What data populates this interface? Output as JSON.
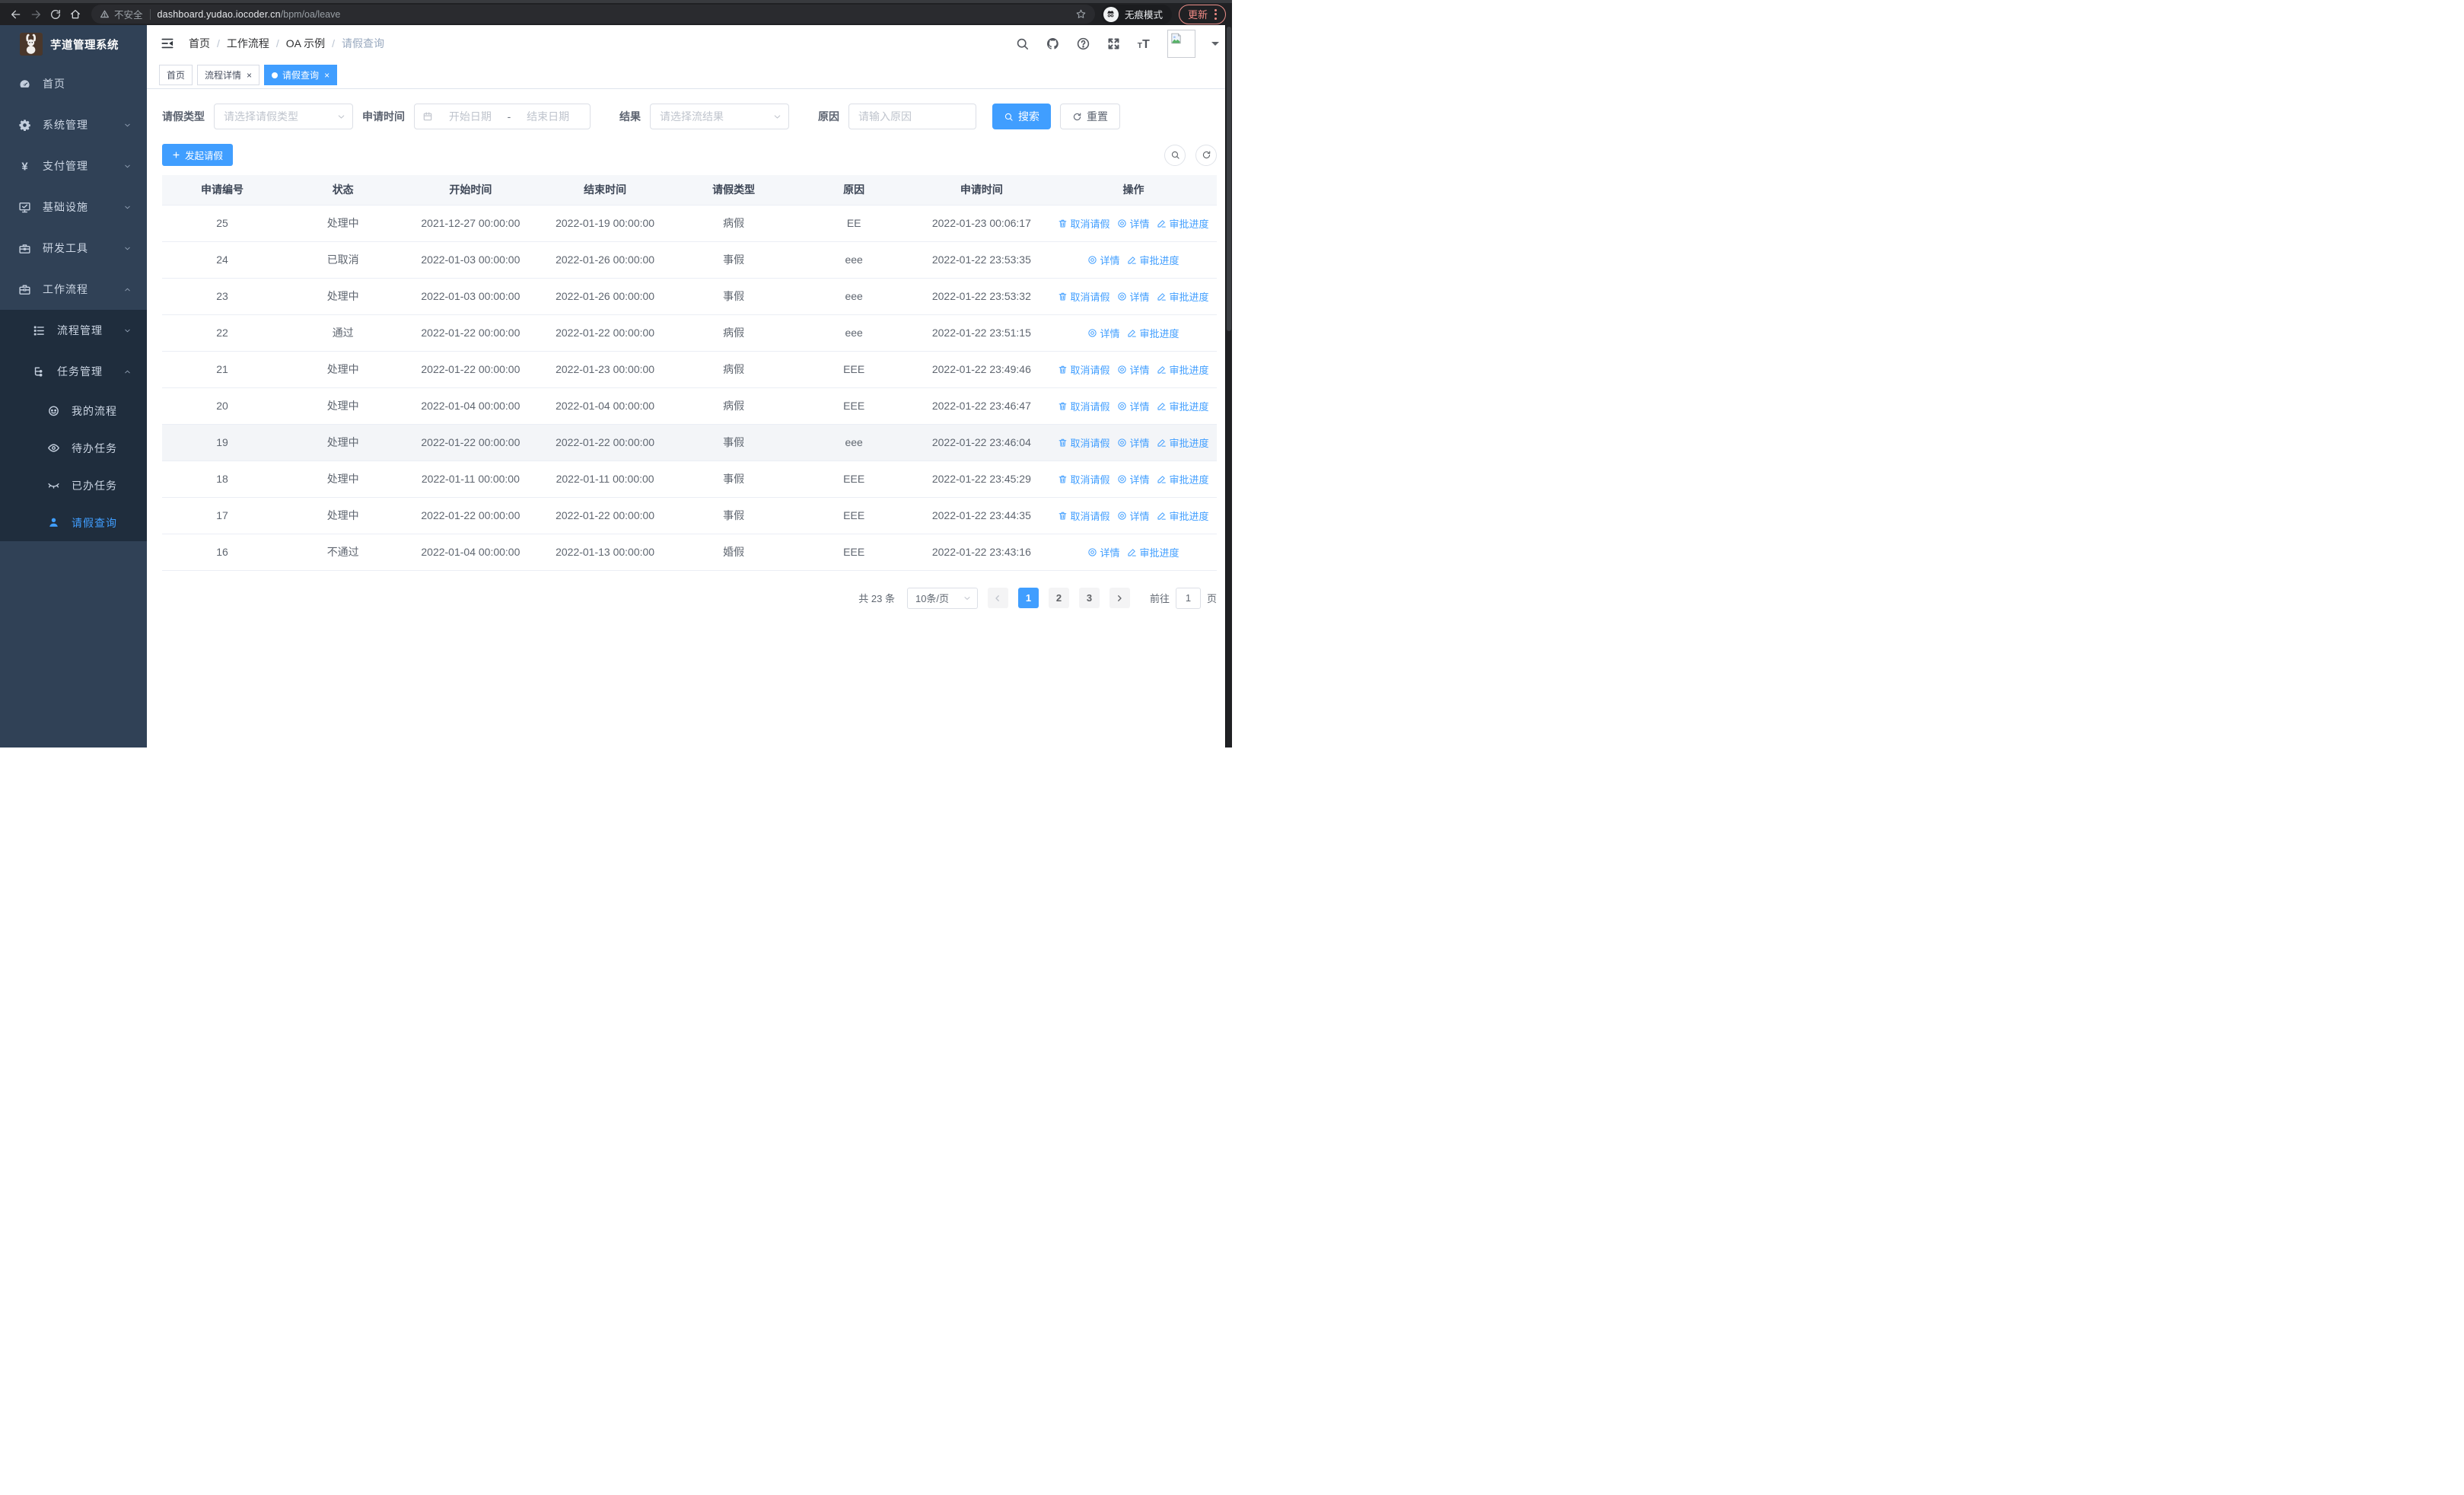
{
  "colors": {
    "primary": "#409eff",
    "sidebar_bg": "#304156",
    "submenu_bg": "#1f2d3d",
    "update_accent": "#f08b85"
  },
  "browser": {
    "security_label": "不安全",
    "url_host": "dashboard.yudao.iocoder.cn",
    "url_path": "/bpm/oa/leave",
    "incognito_label": "无痕模式",
    "update_label": "更新"
  },
  "sidebar": {
    "logo_title": "芋道管理系统",
    "items": [
      {
        "label": "首页",
        "icon": "dashboard-icon"
      },
      {
        "label": "系统管理",
        "icon": "gear-icon",
        "chevron": "down"
      },
      {
        "label": "支付管理",
        "icon": "yen-icon",
        "chevron": "down"
      },
      {
        "label": "基础设施",
        "icon": "monitor-icon",
        "chevron": "down"
      },
      {
        "label": "研发工具",
        "icon": "toolbox-icon",
        "chevron": "down"
      },
      {
        "label": "工作流程",
        "icon": "briefcase-icon",
        "chevron": "up"
      }
    ],
    "submenu": [
      {
        "label": "流程管理",
        "icon": "list-icon",
        "chevron": "down",
        "level": 2
      },
      {
        "label": "任务管理",
        "icon": "tree-icon",
        "chevron": "up",
        "level": 2
      },
      {
        "label": "我的流程",
        "icon": "robot-icon",
        "level": 3
      },
      {
        "label": "待办任务",
        "icon": "eye-icon",
        "level": 3
      },
      {
        "label": "已办任务",
        "icon": "eye-closed-icon",
        "level": 3
      },
      {
        "label": "请假查询",
        "icon": "user-icon",
        "level": 3,
        "active": true
      }
    ]
  },
  "header": {
    "breadcrumb": [
      "首页",
      "工作流程",
      "OA 示例",
      "请假查询"
    ]
  },
  "tabs": [
    {
      "label": "首页"
    },
    {
      "label": "流程详情",
      "closable": true
    },
    {
      "label": "请假查询",
      "closable": true,
      "active": true
    }
  ],
  "filters": {
    "leave_type_label": "请假类型",
    "leave_type_placeholder": "请选择请假类型",
    "apply_time_label": "申请时间",
    "start_placeholder": "开始日期",
    "range_separator": "-",
    "end_placeholder": "结束日期",
    "result_label": "结果",
    "result_placeholder": "请选择流结果",
    "reason_label": "原因",
    "reason_placeholder": "请输入原因",
    "search_label": "搜索",
    "reset_label": "重置"
  },
  "toolbar": {
    "create_label": "发起请假"
  },
  "table": {
    "columns": [
      "申请编号",
      "状态",
      "开始时间",
      "结束时间",
      "请假类型",
      "原因",
      "申请时间",
      "操作"
    ],
    "action_labels": {
      "cancel": "取消请假",
      "detail": "详情",
      "progress": "审批进度"
    },
    "rows": [
      {
        "no": "25",
        "status": "处理中",
        "start": "2021-12-27 00:00:00",
        "end": "2022-01-19 00:00:00",
        "type": "病假",
        "reason": "EE",
        "applied": "2022-01-23 00:06:17",
        "actions": [
          "cancel",
          "detail",
          "progress"
        ]
      },
      {
        "no": "24",
        "status": "已取消",
        "start": "2022-01-03 00:00:00",
        "end": "2022-01-26 00:00:00",
        "type": "事假",
        "reason": "eee",
        "applied": "2022-01-22 23:53:35",
        "actions": [
          "detail",
          "progress"
        ]
      },
      {
        "no": "23",
        "status": "处理中",
        "start": "2022-01-03 00:00:00",
        "end": "2022-01-26 00:00:00",
        "type": "事假",
        "reason": "eee",
        "applied": "2022-01-22 23:53:32",
        "actions": [
          "cancel",
          "detail",
          "progress"
        ]
      },
      {
        "no": "22",
        "status": "通过",
        "start": "2022-01-22 00:00:00",
        "end": "2022-01-22 00:00:00",
        "type": "病假",
        "reason": "eee",
        "applied": "2022-01-22 23:51:15",
        "actions": [
          "detail",
          "progress"
        ]
      },
      {
        "no": "21",
        "status": "处理中",
        "start": "2022-01-22 00:00:00",
        "end": "2022-01-23 00:00:00",
        "type": "病假",
        "reason": "EEE",
        "applied": "2022-01-22 23:49:46",
        "actions": [
          "cancel",
          "detail",
          "progress"
        ]
      },
      {
        "no": "20",
        "status": "处理中",
        "start": "2022-01-04 00:00:00",
        "end": "2022-01-04 00:00:00",
        "type": "病假",
        "reason": "EEE",
        "applied": "2022-01-22 23:46:47",
        "actions": [
          "cancel",
          "detail",
          "progress"
        ]
      },
      {
        "no": "19",
        "status": "处理中",
        "start": "2022-01-22 00:00:00",
        "end": "2022-01-22 00:00:00",
        "type": "事假",
        "reason": "eee",
        "applied": "2022-01-22 23:46:04",
        "actions": [
          "cancel",
          "detail",
          "progress"
        ],
        "highlight": true
      },
      {
        "no": "18",
        "status": "处理中",
        "start": "2022-01-11 00:00:00",
        "end": "2022-01-11 00:00:00",
        "type": "事假",
        "reason": "EEE",
        "applied": "2022-01-22 23:45:29",
        "actions": [
          "cancel",
          "detail",
          "progress"
        ]
      },
      {
        "no": "17",
        "status": "处理中",
        "start": "2022-01-22 00:00:00",
        "end": "2022-01-22 00:00:00",
        "type": "事假",
        "reason": "EEE",
        "applied": "2022-01-22 23:44:35",
        "actions": [
          "cancel",
          "detail",
          "progress"
        ]
      },
      {
        "no": "16",
        "status": "不通过",
        "start": "2022-01-04 00:00:00",
        "end": "2022-01-13 00:00:00",
        "type": "婚假",
        "reason": "EEE",
        "applied": "2022-01-22 23:43:16",
        "actions": [
          "detail",
          "progress"
        ]
      }
    ]
  },
  "pagination": {
    "total_text": "共 23 条",
    "page_size": "10条/页",
    "pages": [
      "1",
      "2",
      "3"
    ],
    "active_page": "1",
    "jump_prefix": "前往",
    "jump_value": "1",
    "jump_suffix": "页"
  }
}
